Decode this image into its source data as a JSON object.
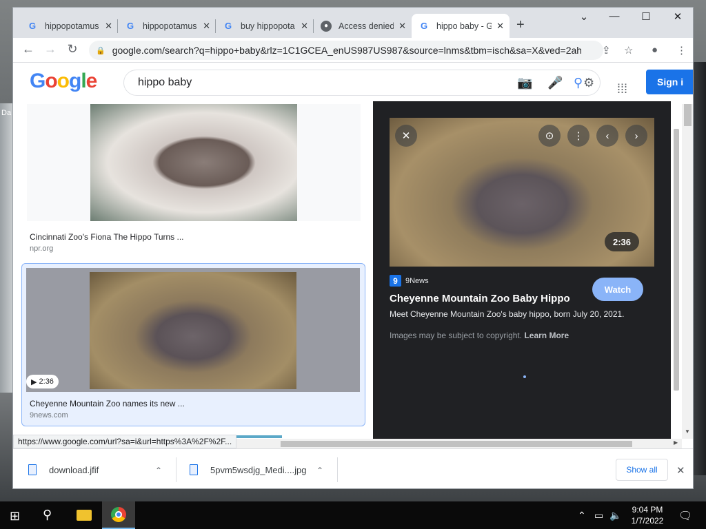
{
  "desktop": {
    "partial_label": "Da"
  },
  "browser": {
    "tabs": [
      {
        "label": "hippopotamus",
        "icon": "google-icon",
        "active": false
      },
      {
        "label": "hippopotamus",
        "icon": "google-icon",
        "active": false
      },
      {
        "label": "buy hippopota",
        "icon": "google-icon",
        "active": false
      },
      {
        "label": "Access denied",
        "icon": "globe-icon",
        "active": false
      },
      {
        "label": "hippo baby - G",
        "icon": "google-icon",
        "active": true
      }
    ],
    "url": "google.com/search?q=hippo+baby&rlz=1C1GCEA_enUS987US987&source=lnms&tbm=isch&sa=X&ved=2ahU...",
    "status_url": "https://www.google.com/url?sa=i&url=https%3A%2F%2F..."
  },
  "google": {
    "logo": "Google",
    "query": "hippo baby",
    "signin_label": "Sign i"
  },
  "results": [
    {
      "title": "Cincinnati Zoo's Fiona The Hippo Turns ...",
      "source": "npr.org"
    },
    {
      "title": "Cheyenne Mountain Zoo names its new ...",
      "source": "9news.com",
      "duration": "2:36"
    }
  ],
  "preview": {
    "duration": "2:36",
    "source_icon": "9",
    "source": "9News",
    "title": "Cheyenne Mountain Zoo Baby Hippo",
    "description": "Meet Cheyenne Mountain Zoo's baby hippo, born July 20, 2021.",
    "copyright": "Images may be subject to copyright.",
    "learn_more": "Learn More",
    "watch_label": "Watch"
  },
  "downloads": {
    "items": [
      {
        "name": "download.jfif"
      },
      {
        "name": "5pvm5wsdjg_Medi....jpg"
      }
    ],
    "show_all": "Show all"
  },
  "taskbar": {
    "time": "9:04 PM",
    "date": "1/7/2022"
  },
  "colors": {
    "accent": "#1a73e8",
    "preview_bg": "#202124",
    "watch_button": "#8ab4f8"
  }
}
